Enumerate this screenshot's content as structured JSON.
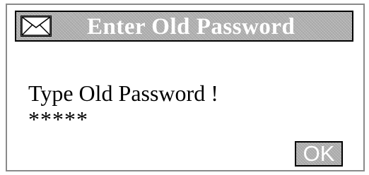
{
  "dialog": {
    "title": "Enter Old Password",
    "title_icon": "envelope-icon",
    "prompt": "Type Old Password !",
    "password_value": "*****",
    "ok_label": "OK"
  },
  "colors": {
    "title_bar_background": "#b4b4b4",
    "title_text": "#ffffff",
    "dialog_border": "#8a8a8a",
    "background": "#ffffff"
  }
}
